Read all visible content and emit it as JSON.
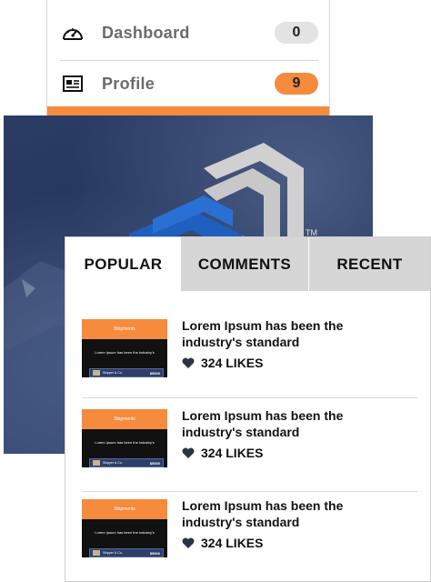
{
  "menu": {
    "items": [
      {
        "label": "Dashboard",
        "badge": "0",
        "icon": "speedometer-icon"
      },
      {
        "label": "Profile",
        "badge": "9",
        "icon": "profile-card-icon"
      }
    ]
  },
  "hero": {
    "trademark": "TM"
  },
  "tabs": [
    "POPULAR",
    "COMMENTS",
    "RECENT"
  ],
  "posts": [
    {
      "title": "Lorem Ipsum has been the industry's standard",
      "likes": "324 LIKES",
      "thumb": {
        "header": "Shipments",
        "text": "Lorem Ipsum has been the industry's",
        "name": "Shipper & Co.",
        "price": "$5000"
      }
    },
    {
      "title": "Lorem Ipsum has been the industry's standard",
      "likes": "324 LIKES",
      "thumb": {
        "header": "Shipments",
        "text": "Lorem Ipsum has been the industry's",
        "name": "Shipper & Co.",
        "price": "$5000"
      }
    },
    {
      "title": "Lorem Ipsum has been the industry's standard",
      "likes": "324 LIKES",
      "thumb": {
        "header": "Shipments",
        "text": "Lorem Ipsum has been the industry's",
        "name": "Shipper & Co.",
        "price": "$5000"
      }
    }
  ],
  "colors": {
    "accent": "#f68a3d",
    "badge_grey": "#e3e3e3",
    "tab_inactive": "#d6d6d6",
    "logo_blue": "#1f5fbf",
    "logo_grey": "#cfcfcf"
  }
}
